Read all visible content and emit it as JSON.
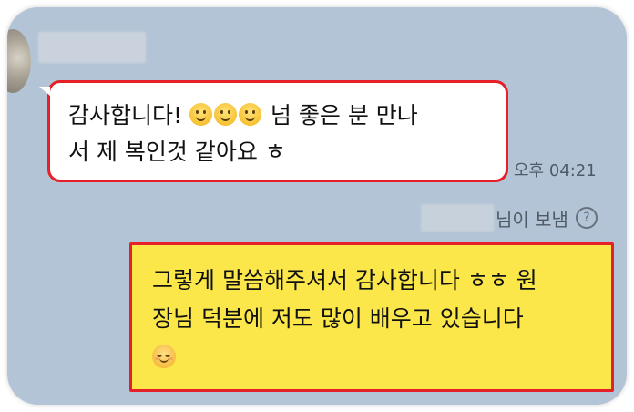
{
  "incoming_message": {
    "text_line1": "감사합니다! ",
    "emoji_icons": [
      "slightly-smiling-face-icon",
      "slightly-smiling-face-icon",
      "slightly-smiling-face-icon"
    ],
    "text_line1_tail": " 넘 좋은 분 만나",
    "text_line2": "서 제 복인것 같아요 ㅎ",
    "time": "오후 04:21"
  },
  "sent_label": {
    "suffix": "님이 보냄",
    "help_icon": "?"
  },
  "outgoing_message": {
    "text_line1": "그렇게 말씀해주셔서 감사합니다 ㅎㅎ 원",
    "text_line2": "장님 덕분에 저도 많이 배우고 있습니다",
    "emoji_icon": "relieved-face-icon"
  },
  "colors": {
    "chat_background": "#b3c4d6",
    "outgoing_bubble": "#fbe74a",
    "incoming_bubble": "#ffffff",
    "highlight_border": "#e62028"
  }
}
